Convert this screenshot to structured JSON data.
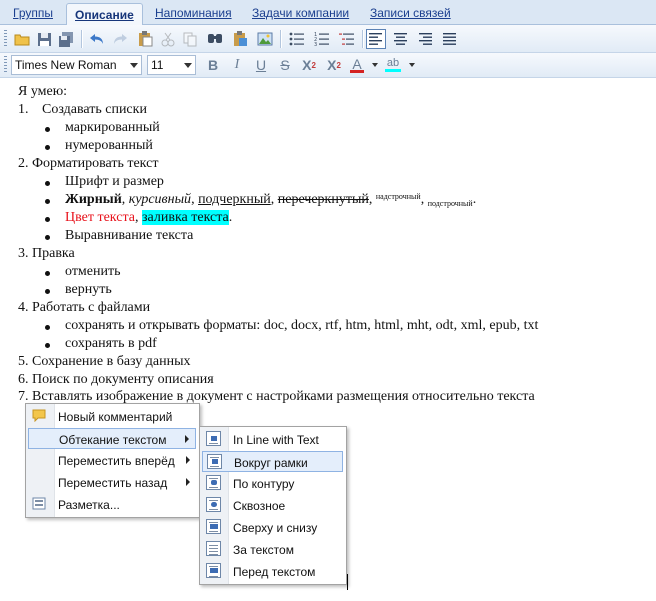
{
  "tabs": [
    {
      "label": "Группы",
      "active": false
    },
    {
      "label": "Описание",
      "active": true
    },
    {
      "label": "Напоминания",
      "active": false
    },
    {
      "label": "Задачи компании",
      "active": false
    },
    {
      "label": "Записи связей",
      "active": false
    }
  ],
  "toolbar": {
    "font_name": "Times New Roman",
    "font_size": "11",
    "bold_label": "B",
    "italic_label": "I",
    "underline_label": "U",
    "strike_label": "S",
    "superscript_label": "X",
    "superscript_mark": "2",
    "subscript_label": "X",
    "subscript_mark": "2",
    "font_color_label": "A",
    "highlight_label": "ab",
    "accent_color": "#2e6fbf",
    "font_color_bar": "#d42323",
    "highlight_color_bar": "#00ffff"
  },
  "document": {
    "intro": "Я умею:",
    "item1_num": "1.",
    "item1": "Создавать списки",
    "item1_bullets": [
      "маркированный",
      "нумерованный"
    ],
    "item2": "2. Форматировать текст",
    "item2_b1": "Шрифт и размер",
    "fmt": {
      "bold": "Жирный",
      "sep1": ", ",
      "italic": "курсивный",
      "sep2": ", ",
      "underline": "подчеркный",
      "sep3": ", ",
      "strike": "перечеркнутый",
      "sep4": ", ",
      "superscript": "надстрочный",
      "sep5": ", ",
      "subscript": "подстрочный",
      "end": "."
    },
    "color_text": "Цвет текста",
    "color_sep": ", ",
    "fill_text": "заливка текста",
    "fill_end": ".",
    "text_red": "#e8121b",
    "fill_cyan": "#00ffff",
    "item2_b4": "Выравнивание текста",
    "item3": "3. Правка",
    "item3_bullets": [
      "отменить",
      "вернуть"
    ],
    "item4": "4. Работать с файлами",
    "item4_bullets": [
      "сохранять и открывать форматы: doc, docx, rtf, htm, html, mht, odt, xml, epub, txt",
      "сохранять в pdf"
    ],
    "item5": "5.  Сохранение в базу данных",
    "item6": "6. Поиск по документу описания",
    "item7": "7. Вставлять изображение в документ  с настройками размещения относительно текста"
  },
  "context_menu": {
    "items": [
      {
        "label": "Новый комментарий",
        "icon": "comment-icon"
      },
      {
        "label": "Обтекание текстом",
        "icon": "",
        "submenu": true
      },
      {
        "label": "Переместить вперёд",
        "icon": "",
        "submenu": true
      },
      {
        "label": "Переместить назад",
        "icon": "",
        "submenu": true
      },
      {
        "label": "Разметка...",
        "icon": "layout-icon"
      }
    ]
  },
  "wrap_submenu": {
    "items": [
      {
        "label": "In Line with Text"
      },
      {
        "label": "Вокруг рамки"
      },
      {
        "label": "По контуру"
      },
      {
        "label": "Сквозное"
      },
      {
        "label": "Сверху и снизу"
      },
      {
        "label": "За текстом"
      },
      {
        "label": "Перед текстом"
      }
    ]
  }
}
